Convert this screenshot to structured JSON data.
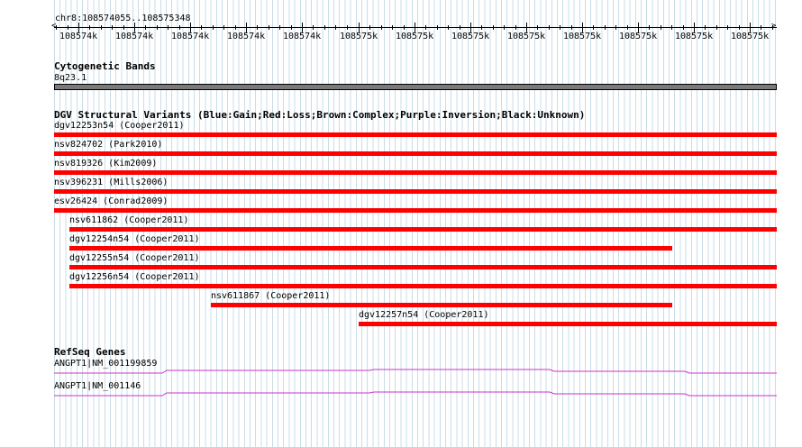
{
  "location": "chr8:108574055..108575348",
  "ruler": {
    "labels": [
      "108574k",
      "108574k",
      "108574k",
      "108574k",
      "108574k",
      "108575k",
      "108575k",
      "108575k",
      "108575k",
      "108575k",
      "108575k",
      "108575k",
      "108575k"
    ]
  },
  "tracks": {
    "cytobands": {
      "title": "Cytogenetic Bands",
      "band": "8q23.1"
    },
    "dgv": {
      "title": "DGV Structural Variants (Blue:Gain;Red:Loss;Brown:Complex;Purple:Inversion;Black:Unknown)",
      "loss_color": "#ff0000",
      "variants": [
        {
          "label": "dgv12253n54 (Cooper2011)",
          "start": 0.0,
          "end": 1.0
        },
        {
          "label": "nsv824702 (Park2010)",
          "start": 0.0,
          "end": 1.0
        },
        {
          "label": "nsv819326 (Kim2009)",
          "start": 0.0,
          "end": 1.0
        },
        {
          "label": "nsv396231 (Mills2006)",
          "start": 0.0,
          "end": 1.0
        },
        {
          "label": "esv26424 (Conrad2009)",
          "start": 0.0,
          "end": 1.0
        },
        {
          "label": "nsv611862 (Cooper2011)",
          "start": 0.021,
          "end": 1.0
        },
        {
          "label": "dgv12254n54 (Cooper2011)",
          "start": 0.021,
          "end": 0.855
        },
        {
          "label": "dgv12255n54 (Cooper2011)",
          "start": 0.021,
          "end": 1.0
        },
        {
          "label": "dgv12256n54 (Cooper2011)",
          "start": 0.021,
          "end": 1.0
        },
        {
          "label": "nsv611867 (Cooper2011)",
          "start": 0.217,
          "end": 0.855
        },
        {
          "label": "dgv12257n54 (Cooper2011)",
          "start": 0.421,
          "end": 1.0
        }
      ]
    },
    "refseq": {
      "title": "RefSeq Genes",
      "color": "#cc33cc",
      "genes": [
        {
          "label": "ANGPT1|NM_001199859"
        },
        {
          "label": "ANGPT1|NM_001146"
        }
      ]
    }
  }
}
